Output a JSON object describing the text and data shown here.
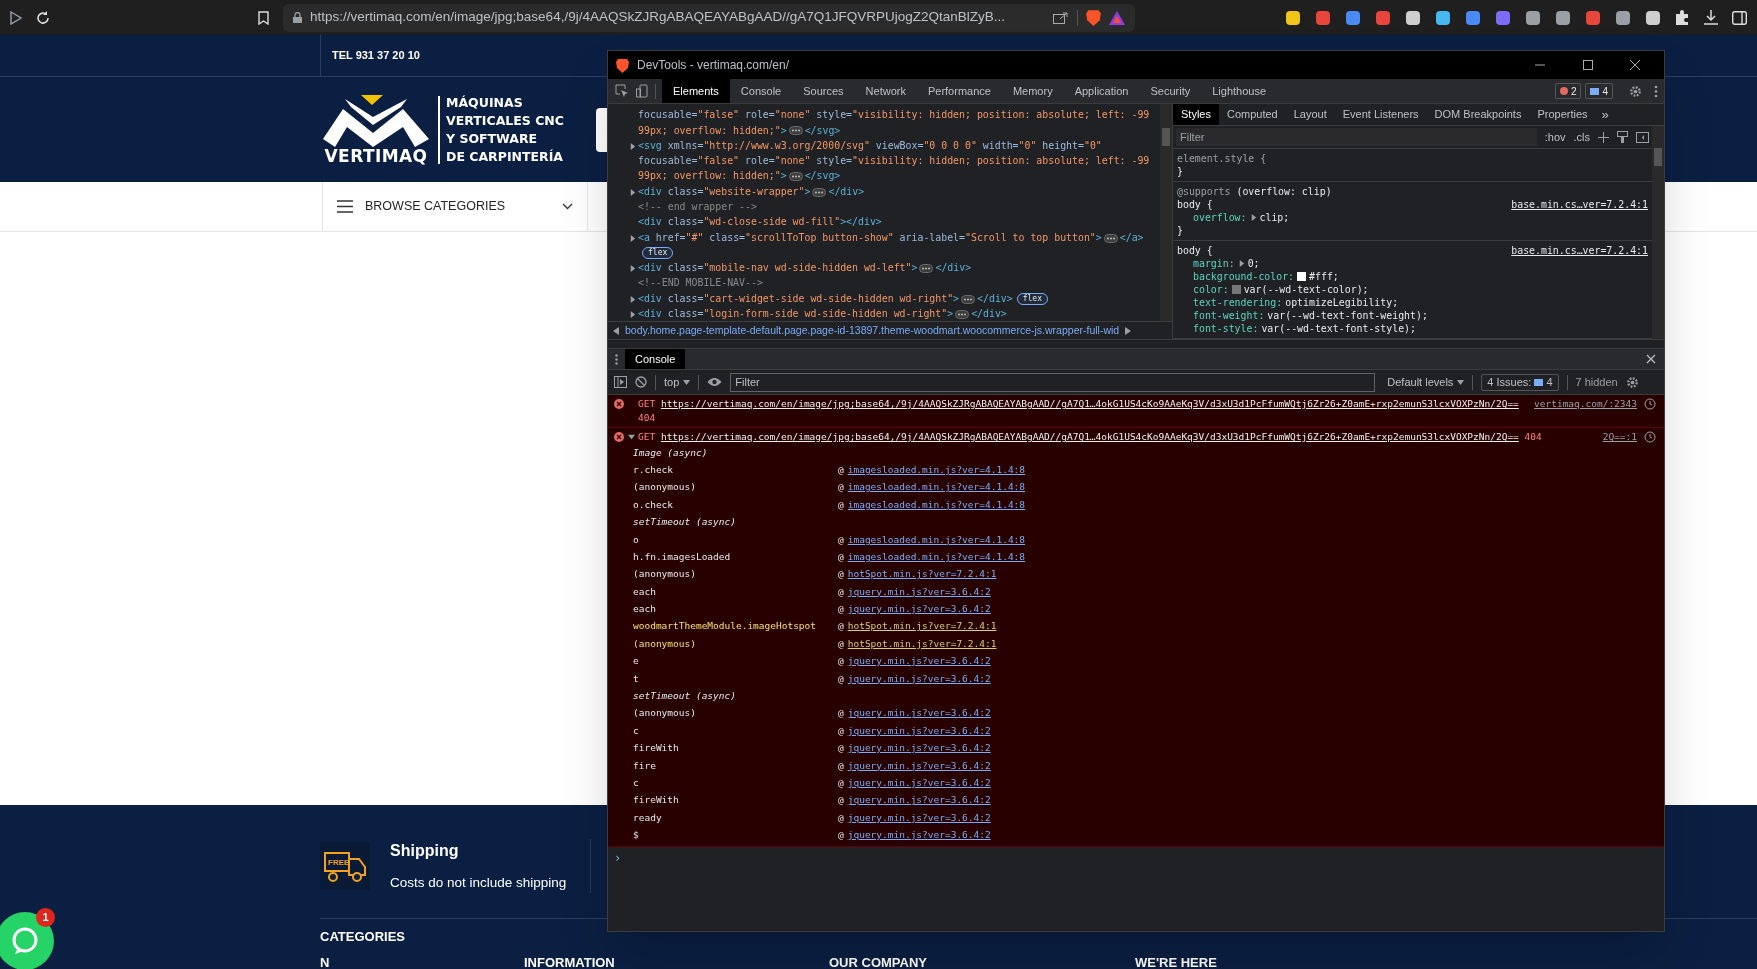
{
  "browser": {
    "url": "https://vertimaq.com/en/image/jpg;base64,/9j/4AAQSkZJRgABAQEAYABgAAD//gA7Q1JFQVRPUjogZ2QtanBlZyB..."
  },
  "site": {
    "phone": "TEL 931 37 20 10",
    "logo": {
      "brand": "VERTIMAQ",
      "tagline": [
        "MÁQUINAS",
        "VERTICALES CNC",
        "Y SOFTWARE",
        "DE CARPINTERÍA"
      ]
    },
    "browse": "BROWSE CATEGORIES",
    "footer": {
      "feature": {
        "badge": "FREE",
        "title": "Shipping",
        "text": "Costs do not include shipping"
      },
      "headings": [
        {
          "text": "CATEGORIES",
          "kind": "section"
        },
        {
          "text": "N",
          "kind": "column"
        },
        {
          "text": "INFORMATION",
          "kind": "column"
        },
        {
          "text": "OUR COMPANY",
          "kind": "column"
        },
        {
          "text": "WE'RE HERE",
          "kind": "column"
        }
      ]
    },
    "whatsapp_badge": "1"
  },
  "devtools": {
    "title": "DevTools - vertimaq.com/en/",
    "tabs": [
      {
        "label": "Elements",
        "selected": true
      },
      {
        "label": "Console",
        "selected": false
      },
      {
        "label": "Sources",
        "selected": false
      },
      {
        "label": "Network",
        "selected": false
      },
      {
        "label": "Performance",
        "selected": false
      },
      {
        "label": "Memory",
        "selected": false
      },
      {
        "label": "Application",
        "selected": false
      },
      {
        "label": "Security",
        "selected": false
      },
      {
        "label": "Lighthouse",
        "selected": false
      }
    ],
    "error_count": "2",
    "message_count": "4",
    "elements": [
      {
        "expandable": false,
        "parts": [
          {
            "kind": "attr",
            "text": "focusable="
          },
          {
            "kind": "val",
            "text": "\"false\""
          },
          {
            "kind": "attr",
            "text": " role="
          },
          {
            "kind": "val",
            "text": "\"none\""
          },
          {
            "kind": "attr",
            "text": " style="
          },
          {
            "kind": "val",
            "text": "\"visibility: hidden; position: absolute; left: -99"
          }
        ]
      },
      {
        "expandable": false,
        "parts": [
          {
            "kind": "val",
            "text": "99px; overflow: hidden;\""
          },
          {
            "kind": "tag",
            "text": ">"
          },
          {
            "kind": "dots"
          },
          {
            "kind": "tag",
            "text": "</svg>"
          }
        ]
      },
      {
        "expandable": true,
        "parts": [
          {
            "kind": "tag",
            "text": "<svg"
          },
          {
            "kind": "attr",
            "text": " xmlns="
          },
          {
            "kind": "val",
            "text": "\"http://www.w3.org/2000/svg\""
          },
          {
            "kind": "attr",
            "text": " viewBox="
          },
          {
            "kind": "val",
            "text": "\"0 0 0 0\""
          },
          {
            "kind": "attr",
            "text": " width="
          },
          {
            "kind": "val",
            "text": "\"0\""
          },
          {
            "kind": "attr",
            "text": " height="
          },
          {
            "kind": "val",
            "text": "\"0\""
          }
        ]
      },
      {
        "expandable": false,
        "parts": [
          {
            "kind": "attr",
            "text": "focusable="
          },
          {
            "kind": "val",
            "text": "\"false\""
          },
          {
            "kind": "attr",
            "text": " role="
          },
          {
            "kind": "val",
            "text": "\"none\""
          },
          {
            "kind": "attr",
            "text": " style="
          },
          {
            "kind": "val",
            "text": "\"visibility: hidden; position: absolute; left: -99"
          }
        ]
      },
      {
        "expandable": false,
        "parts": [
          {
            "kind": "val",
            "text": "99px; overflow: hidden;\""
          },
          {
            "kind": "tag",
            "text": ">"
          },
          {
            "kind": "dots"
          },
          {
            "kind": "tag",
            "text": "</svg>"
          }
        ]
      },
      {
        "expandable": true,
        "parts": [
          {
            "kind": "tag",
            "text": "<div"
          },
          {
            "kind": "attr",
            "text": " class="
          },
          {
            "kind": "val",
            "text": "\"website-wrapper\""
          },
          {
            "kind": "tag",
            "text": ">"
          },
          {
            "kind": "dots"
          },
          {
            "kind": "tag",
            "text": "</div>"
          }
        ]
      },
      {
        "expandable": false,
        "parts": [
          {
            "kind": "comment",
            "text": "<!-- end wrapper -->"
          }
        ]
      },
      {
        "expandable": false,
        "parts": [
          {
            "kind": "tag",
            "text": "<div"
          },
          {
            "kind": "attr",
            "text": " class="
          },
          {
            "kind": "val",
            "text": "\"wd-close-side wd-fill\""
          },
          {
            "kind": "tag",
            "text": "></div>"
          }
        ]
      },
      {
        "expandable": true,
        "parts": [
          {
            "kind": "tag",
            "text": "<a"
          },
          {
            "kind": "attr",
            "text": " href="
          },
          {
            "kind": "val",
            "text": "\"#\""
          },
          {
            "kind": "attr",
            "text": " class="
          },
          {
            "kind": "val",
            "text": "\"scrollToTop button-show\""
          },
          {
            "kind": "attr",
            "text": " aria-label="
          },
          {
            "kind": "val",
            "text": "\"Scroll to top button\""
          },
          {
            "kind": "tag",
            "text": ">"
          },
          {
            "kind": "dots"
          },
          {
            "kind": "tag",
            "text": "</a>"
          }
        ]
      },
      {
        "expandable": false,
        "badge": "flex"
      },
      {
        "expandable": true,
        "parts": [
          {
            "kind": "tag",
            "text": "<div"
          },
          {
            "kind": "attr",
            "text": " class="
          },
          {
            "kind": "val",
            "text": "\"mobile-nav wd-side-hidden wd-left\""
          },
          {
            "kind": "tag",
            "text": ">"
          },
          {
            "kind": "dots"
          },
          {
            "kind": "tag",
            "text": "</div>"
          }
        ]
      },
      {
        "expandable": false,
        "parts": [
          {
            "kind": "comment",
            "text": "<!--END MOBILE-NAV-->"
          }
        ]
      },
      {
        "expandable": true,
        "badge": "flex",
        "parts": [
          {
            "kind": "tag",
            "text": "<div"
          },
          {
            "kind": "attr",
            "text": " class="
          },
          {
            "kind": "val",
            "text": "\"cart-widget-side wd-side-hidden wd-right\""
          },
          {
            "kind": "tag",
            "text": ">"
          },
          {
            "kind": "dots"
          },
          {
            "kind": "tag",
            "text": "</div>"
          }
        ]
      },
      {
        "expandable": true,
        "parts": [
          {
            "kind": "tag",
            "text": "<div"
          },
          {
            "kind": "attr",
            "text": " class="
          },
          {
            "kind": "val",
            "text": "\"login-form-side wd-side-hidden wd-right\""
          },
          {
            "kind": "tag",
            "text": ">"
          },
          {
            "kind": "dots"
          },
          {
            "kind": "tag",
            "text": "</div>"
          }
        ]
      }
    ],
    "breadcrumb": "body.home.page-template-default.page.page-id-13897.theme-woodmart.woocommerce-js.wrapper-full-wid",
    "styles_tabs": [
      {
        "label": "Styles",
        "selected": true
      },
      {
        "label": "Computed",
        "selected": false
      },
      {
        "label": "Layout",
        "selected": false
      },
      {
        "label": "Event Listeners",
        "selected": false
      },
      {
        "label": "DOM Breakpoints",
        "selected": false
      },
      {
        "label": "Properties",
        "selected": false
      }
    ],
    "styles_more": "»",
    "styles_filter": {
      "placeholder": "Filter"
    },
    "hov": ":hov",
    "cls": ".cls",
    "rules": [
      {
        "selector": "element.style {",
        "inline": true,
        "close": "}"
      },
      {
        "inline": false,
        "at_rule": "@supports",
        "condition": "(overflow: clip)",
        "selector": "body {",
        "source": "base.min.cs…ver=7.2.4:1",
        "close": "}",
        "props": [
          {
            "name": "overflow:",
            "value": "clip;",
            "expandable": true
          }
        ]
      },
      {
        "selector": "body {",
        "inline": false,
        "source": "base.min.cs…ver=7.2.4:1",
        "props": [
          {
            "name": "margin:",
            "value": "0;",
            "expandable": true
          },
          {
            "name": "background-color:",
            "value": "#fff;",
            "expandable": false,
            "color": "#ffffff"
          },
          {
            "name": "color:",
            "value": "var(--wd-text-color);",
            "expandable": false,
            "color": "#777777"
          },
          {
            "name": "text-rendering:",
            "value": "optimizeLegibility;",
            "expandable": false
          },
          {
            "name": "font-weight:",
            "value": "var(--wd-text-font-weight);",
            "expandable": false
          },
          {
            "name": "font-style:",
            "value": "var(--wd-text-font-style);",
            "expandable": false
          }
        ]
      }
    ],
    "console": {
      "tab": "Console",
      "context": "top",
      "filter": {
        "placeholder": "Filter"
      },
      "levels": "Default levels",
      "issues": "4 Issues:",
      "issues_count": "4",
      "hidden": "7 hidden",
      "messages": [
        {
          "method": "GET",
          "url": "https://vertimaq.com/en/image/jpg;base64,/9j/4AAQSkZJRgABAQEAYABgAAD//gA7Q1…4okG1US4cKo9AAeKq3V/d3xU3d1PcFfumWQtj6Zr26+Z0amE+rxp2emunS3lcxVOXPzNn/2Q==",
          "status": "404",
          "source": "vertimaq.com/:2343",
          "expanded": false
        },
        {
          "method": "GET",
          "url": "https://vertimaq.com/en/image/jpg;base64,/9j/4AAQSkZJRgABAQEAYABgAAD//gA7Q1…4okG1US4cKo9AAeKq3V/d3xU3d1PcFfumWQtj6Zr26+Z0amE+rxp2emunS3lcxVOXPzNn/2Q==",
          "status": "404",
          "source": "2Q==:1",
          "expanded": true,
          "stack": [
            {
              "kind": "async",
              "label": "Image (async)"
            },
            {
              "kind": "frame",
              "fn": "r.check",
              "at": "@",
              "source": "imagesloaded.min.js?ver=4.1.4:8",
              "highlighted": false
            },
            {
              "kind": "frame",
              "fn": "(anonymous)",
              "at": "@",
              "source": "imagesloaded.min.js?ver=4.1.4:8",
              "highlighted": false
            },
            {
              "kind": "frame",
              "fn": "o.check",
              "at": "@",
              "source": "imagesloaded.min.js?ver=4.1.4:8",
              "highlighted": false
            },
            {
              "kind": "async",
              "label": "setTimeout (async)"
            },
            {
              "kind": "frame",
              "fn": "o",
              "at": "@",
              "source": "imagesloaded.min.js?ver=4.1.4:8",
              "highlighted": false
            },
            {
              "kind": "frame",
              "fn": "h.fn.imagesLoaded",
              "at": "@",
              "source": "imagesloaded.min.js?ver=4.1.4:8",
              "highlighted": false
            },
            {
              "kind": "frame",
              "fn": "(anonymous)",
              "at": "@",
              "source": "hotSpot.min.js?ver=7.2.4:1",
              "highlighted": false
            },
            {
              "kind": "frame",
              "fn": "each",
              "at": "@",
              "source": "jquery.min.js?ver=3.6.4:2",
              "highlighted": false
            },
            {
              "kind": "frame",
              "fn": "each",
              "at": "@",
              "source": "jquery.min.js?ver=3.6.4:2",
              "highlighted": false
            },
            {
              "kind": "frame",
              "fn": "woodmartThemeModule.imageHotspot",
              "at": "@",
              "source": "hotSpot.min.js?ver=7.2.4:1",
              "highlighted": true
            },
            {
              "kind": "frame",
              "fn": "(anonymous)",
              "at": "@",
              "source": "hotSpot.min.js?ver=7.2.4:1",
              "highlighted": true
            },
            {
              "kind": "frame",
              "fn": "e",
              "at": "@",
              "source": "jquery.min.js?ver=3.6.4:2",
              "highlighted": false
            },
            {
              "kind": "frame",
              "fn": "t",
              "at": "@",
              "source": "jquery.min.js?ver=3.6.4:2",
              "highlighted": false
            },
            {
              "kind": "async",
              "label": "setTimeout (async)"
            },
            {
              "kind": "frame",
              "fn": "(anonymous)",
              "at": "@",
              "source": "jquery.min.js?ver=3.6.4:2",
              "highlighted": false
            },
            {
              "kind": "frame",
              "fn": "c",
              "at": "@",
              "source": "jquery.min.js?ver=3.6.4:2",
              "highlighted": false
            },
            {
              "kind": "frame",
              "fn": "fireWith",
              "at": "@",
              "source": "jquery.min.js?ver=3.6.4:2",
              "highlighted": false
            },
            {
              "kind": "frame",
              "fn": "fire",
              "at": "@",
              "source": "jquery.min.js?ver=3.6.4:2",
              "highlighted": false
            },
            {
              "kind": "frame",
              "fn": "c",
              "at": "@",
              "source": "jquery.min.js?ver=3.6.4:2",
              "highlighted": false
            },
            {
              "kind": "frame",
              "fn": "fireWith",
              "at": "@",
              "source": "jquery.min.js?ver=3.6.4:2",
              "highlighted": false
            },
            {
              "kind": "frame",
              "fn": "ready",
              "at": "@",
              "source": "jquery.min.js?ver=3.6.4:2",
              "highlighted": false
            },
            {
              "kind": "frame",
              "fn": "$",
              "at": "@",
              "source": "jquery.min.js?ver=3.6.4:2",
              "highlighted": false
            }
          ]
        }
      ],
      "prompt": "›"
    }
  }
}
